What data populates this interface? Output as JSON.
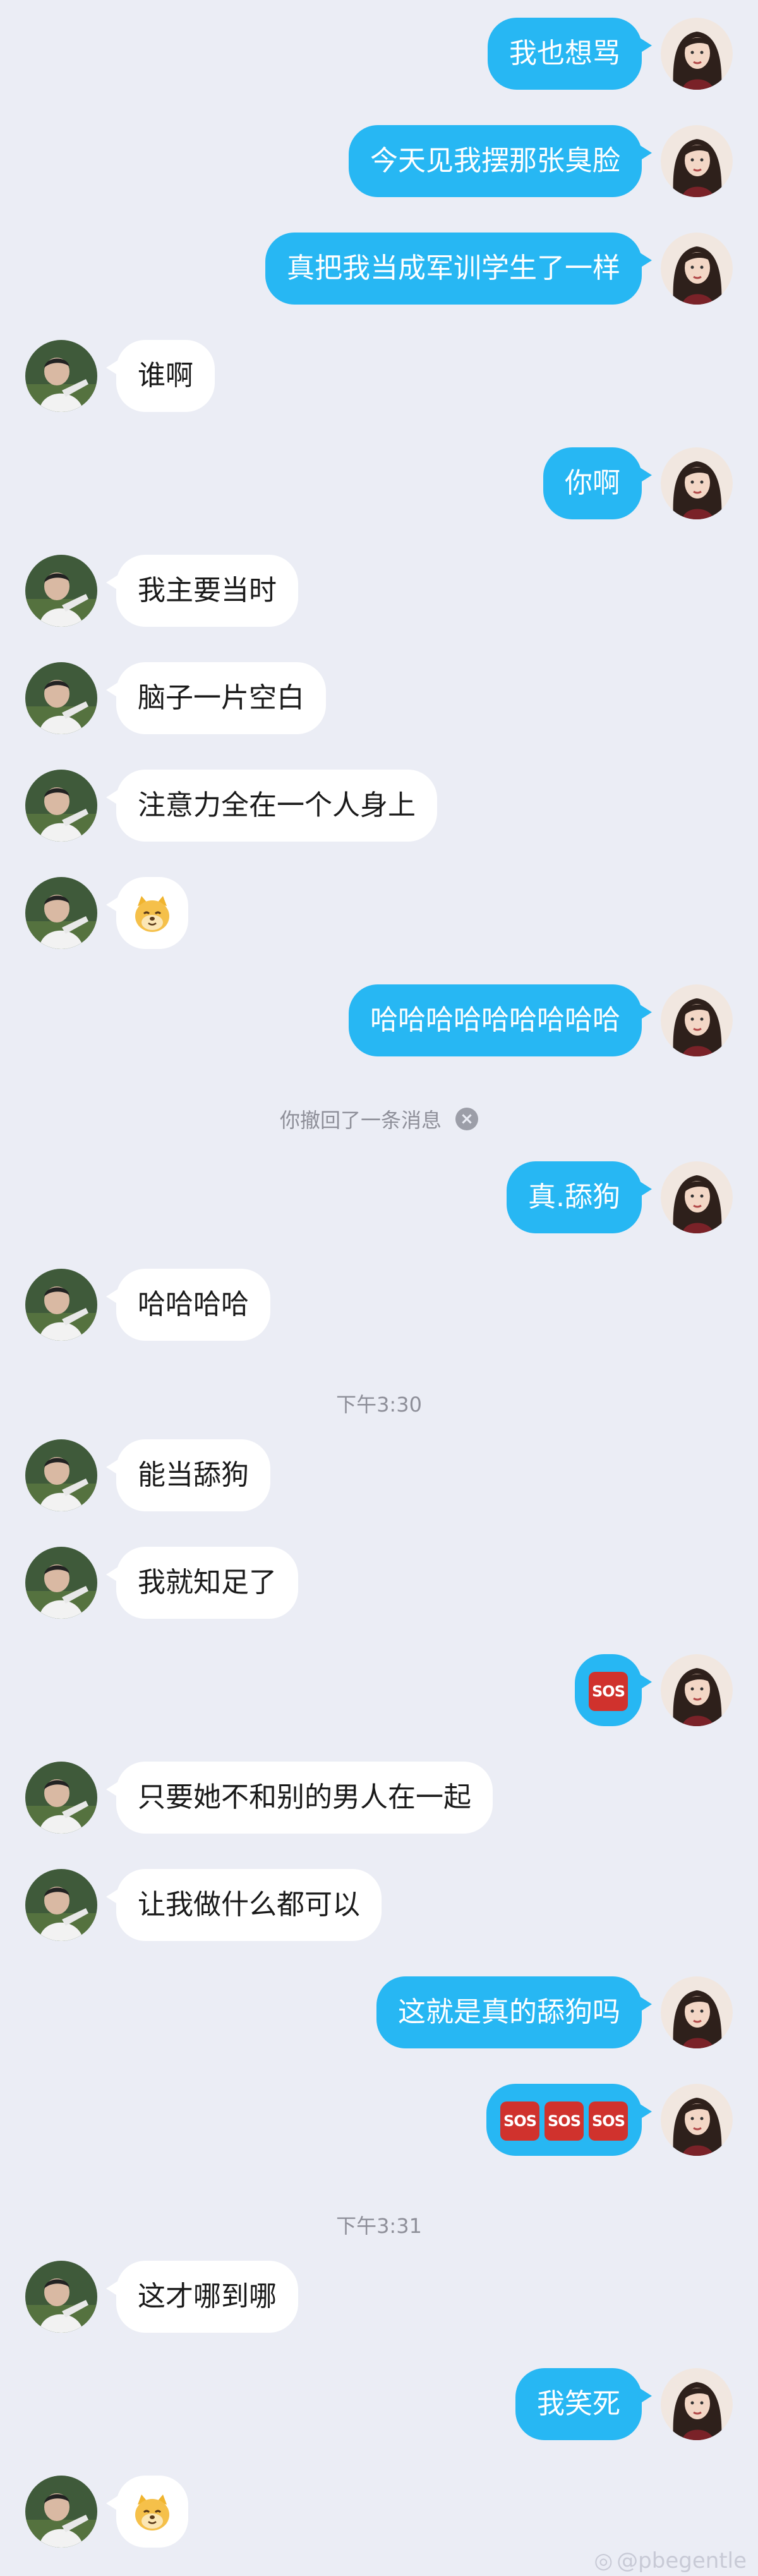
{
  "messages": [
    {
      "side": "me",
      "text": "我也想骂"
    },
    {
      "side": "me",
      "text": "今天见我摆那张臭脸"
    },
    {
      "side": "me",
      "text": "真把我当成军训学生了一样"
    },
    {
      "side": "other",
      "text": "谁啊"
    },
    {
      "side": "me",
      "text": "你啊"
    },
    {
      "side": "other",
      "text": "我主要当时"
    },
    {
      "side": "other",
      "text": "脑子一片空白"
    },
    {
      "side": "other",
      "text": "注意力全在一个人身上"
    },
    {
      "side": "other",
      "sticker": "doge-face-emoji"
    },
    {
      "side": "me",
      "text": "哈哈哈哈哈哈哈哈哈"
    },
    {
      "system": "你撤回了一条消息"
    },
    {
      "side": "me",
      "text": "真.舔狗"
    },
    {
      "side": "other",
      "text": "哈哈哈哈"
    },
    {
      "time": "下午3:30"
    },
    {
      "side": "other",
      "text": "能当舔狗"
    },
    {
      "side": "other",
      "text": "我就知足了"
    },
    {
      "side": "me",
      "sos": 1
    },
    {
      "side": "other",
      "text": "只要她不和别的男人在一起"
    },
    {
      "side": "other",
      "text": "让我做什么都可以"
    },
    {
      "side": "me",
      "text": "这就是真的舔狗吗"
    },
    {
      "side": "me",
      "sos": 3
    },
    {
      "time": "下午3:31"
    },
    {
      "side": "other",
      "text": "这才哪到哪"
    },
    {
      "side": "me",
      "text": "我笑死"
    },
    {
      "side": "other",
      "sticker": "doge-face-emoji"
    }
  ],
  "sos_label": "SOS",
  "watermark": "@pbegentle",
  "colors": {
    "background": "#ebedf5",
    "my_bubble": "#27b7f3",
    "other_bubble": "#ffffff"
  }
}
